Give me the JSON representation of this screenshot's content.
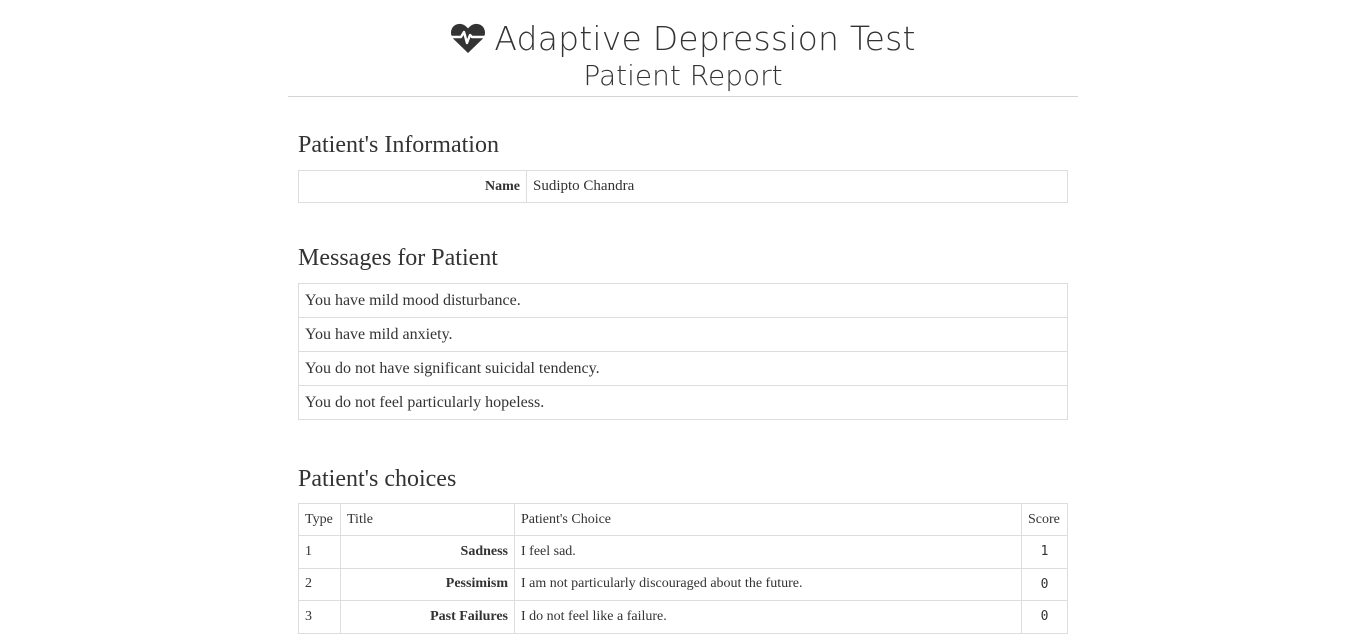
{
  "header": {
    "title": "Adaptive Depression Test",
    "subtitle": "Patient Report",
    "icon": "heartbeat-icon"
  },
  "patient_info": {
    "heading": "Patient's Information",
    "name_label": "Name",
    "name_value": "Sudipto Chandra"
  },
  "messages": {
    "heading": "Messages for Patient",
    "items": [
      "You have mild mood disturbance.",
      "You have mild anxiety.",
      "You do not have significant suicidal tendency.",
      "You do not feel particularly hopeless."
    ]
  },
  "choices": {
    "heading": "Patient's choices",
    "columns": [
      "Type",
      "Title",
      "Patient's Choice",
      "Score"
    ],
    "rows": [
      {
        "type": "1",
        "title": "Sadness",
        "choice": "I feel sad.",
        "score": "1"
      },
      {
        "type": "2",
        "title": "Pessimism",
        "choice": "I am not particularly discouraged about the future.",
        "score": "0"
      },
      {
        "type": "3",
        "title": "Past Failures",
        "choice": "I do not feel like a failure.",
        "score": "0"
      }
    ]
  }
}
